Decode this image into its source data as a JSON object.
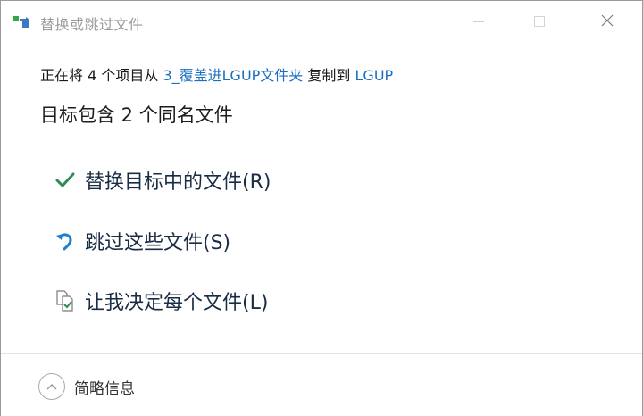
{
  "window": {
    "title": "替换或跳过文件"
  },
  "message": {
    "prefix": "正在将 4 个项目从 ",
    "source": "3_覆盖进LGUP文件夹",
    "middle": " 复制到 ",
    "destination": "LGUP"
  },
  "heading": "目标包含 2 个同名文件",
  "options": [
    {
      "label": "替换目标中的文件(R)",
      "icon": "check-icon"
    },
    {
      "label": "跳过这些文件(S)",
      "icon": "skip-arrow-icon"
    },
    {
      "label": "让我决定每个文件(L)",
      "icon": "compare-files-icon"
    }
  ],
  "footer": {
    "details_label": "简略信息"
  },
  "colors": {
    "link": "#1b6ec2",
    "check": "#2e8b57",
    "skip": "#1f7fd0"
  }
}
